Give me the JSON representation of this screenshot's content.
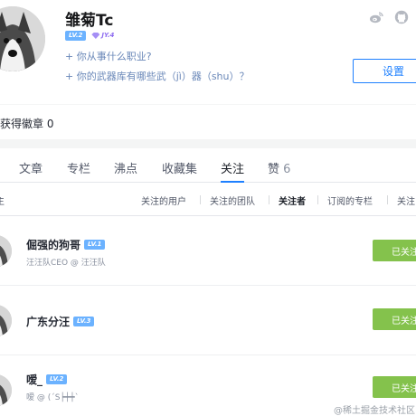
{
  "profile": {
    "name": "雏菊Tc",
    "level_badge": "LV.2",
    "jy_badge": "JY.4",
    "prompt_job": "+ 你从事什么职业?",
    "prompt_weapons": "+ 你的武器库有哪些武（jì）器（shu）？",
    "settings_label": "设置",
    "social_icons": [
      "weibo-icon",
      "github-icon"
    ]
  },
  "badges": {
    "count_label": "获得徽章 0"
  },
  "tabs": [
    {
      "label": "文章"
    },
    {
      "label": "专栏"
    },
    {
      "label": "沸点"
    },
    {
      "label": "收藏集"
    },
    {
      "label": "关注",
      "active": true
    },
    {
      "label": "赞",
      "count": "6"
    }
  ],
  "subtabs": {
    "left_partial": "主",
    "items": [
      {
        "label": "关注的用户"
      },
      {
        "label": "关注的团队"
      },
      {
        "label": "关注者",
        "active": true
      },
      {
        "label": "订阅的专栏"
      },
      {
        "label": "关注"
      }
    ]
  },
  "followers": [
    {
      "name": "倔强的狗哥",
      "level": "LV.1",
      "desc": "汪汪队CEO @ 汪汪队",
      "button": "已关注"
    },
    {
      "name": "广东分汪",
      "level": "LV.3",
      "desc": "",
      "button": "已关注"
    },
    {
      "name": "嗳_",
      "level": "LV.2",
      "desc": "嗳 @ (ˊS┝┿┿ˋ",
      "button": "已关注"
    }
  ],
  "watermark": "@稀土掘金技术社区",
  "colors": {
    "accent": "#1e80ff",
    "followed_button": "#84c24c",
    "level_badge": "#6bb2ff",
    "prompt_link": "#6987b8"
  }
}
